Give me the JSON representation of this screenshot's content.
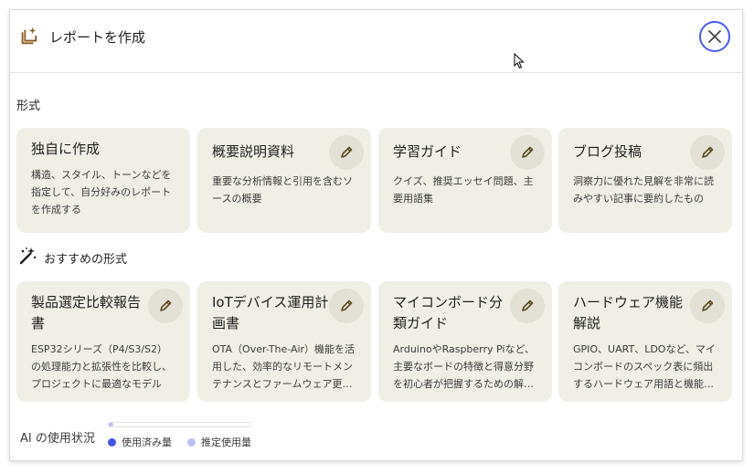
{
  "dialog": {
    "title": "レポートを作成",
    "icon": "report-spark-icon",
    "close_icon": "close-icon"
  },
  "formats": {
    "label": "形式",
    "cards": [
      {
        "title": "独自に作成",
        "desc": "構造、スタイル、トーンなどを指定して、自分好みのレポートを作成する",
        "editable": false
      },
      {
        "title": "概要説明資料",
        "desc": "重要な分析情報と引用を含むソースの概要",
        "editable": true
      },
      {
        "title": "学習ガイド",
        "desc": "クイズ、推奨エッセイ問題、主要用語集",
        "editable": true
      },
      {
        "title": "ブログ投稿",
        "desc": "洞察力に優れた見解を非常に読みやすい記事に要約したもの",
        "editable": true
      }
    ]
  },
  "recommended": {
    "label": "おすすめの形式",
    "icon": "magic-wand-icon",
    "cards": [
      {
        "title": "製品選定比較報告書",
        "desc": "ESP32シリーズ（P4/S3/S2）の処理能力と拡張性を比較し、プロジェクトに最適なモデルを…"
      },
      {
        "title": "IoTデバイス運用計画書",
        "desc": "OTA（Over-The-Air）機能を活用した、効率的なリモートメンテナンスとファームウェア更…"
      },
      {
        "title": "マイコンボード分類ガイド",
        "desc": "ArduinoやRaspberry Piなど、主要なボードの特徴と得意分野を初心者が把握するための解…"
      },
      {
        "title": "ハードウェア機能解説",
        "desc": "GPIO、UART、LDOなど、マイコンボードのスペック表に頻出するハードウェア用語と機能…"
      }
    ]
  },
  "usage": {
    "label": "AI の使用状況",
    "used_fraction": 0.03,
    "legend": [
      {
        "label": "使用済み量",
        "color": "#4355e6"
      },
      {
        "label": "推定使用量",
        "color": "#b9c1f3"
      }
    ]
  }
}
